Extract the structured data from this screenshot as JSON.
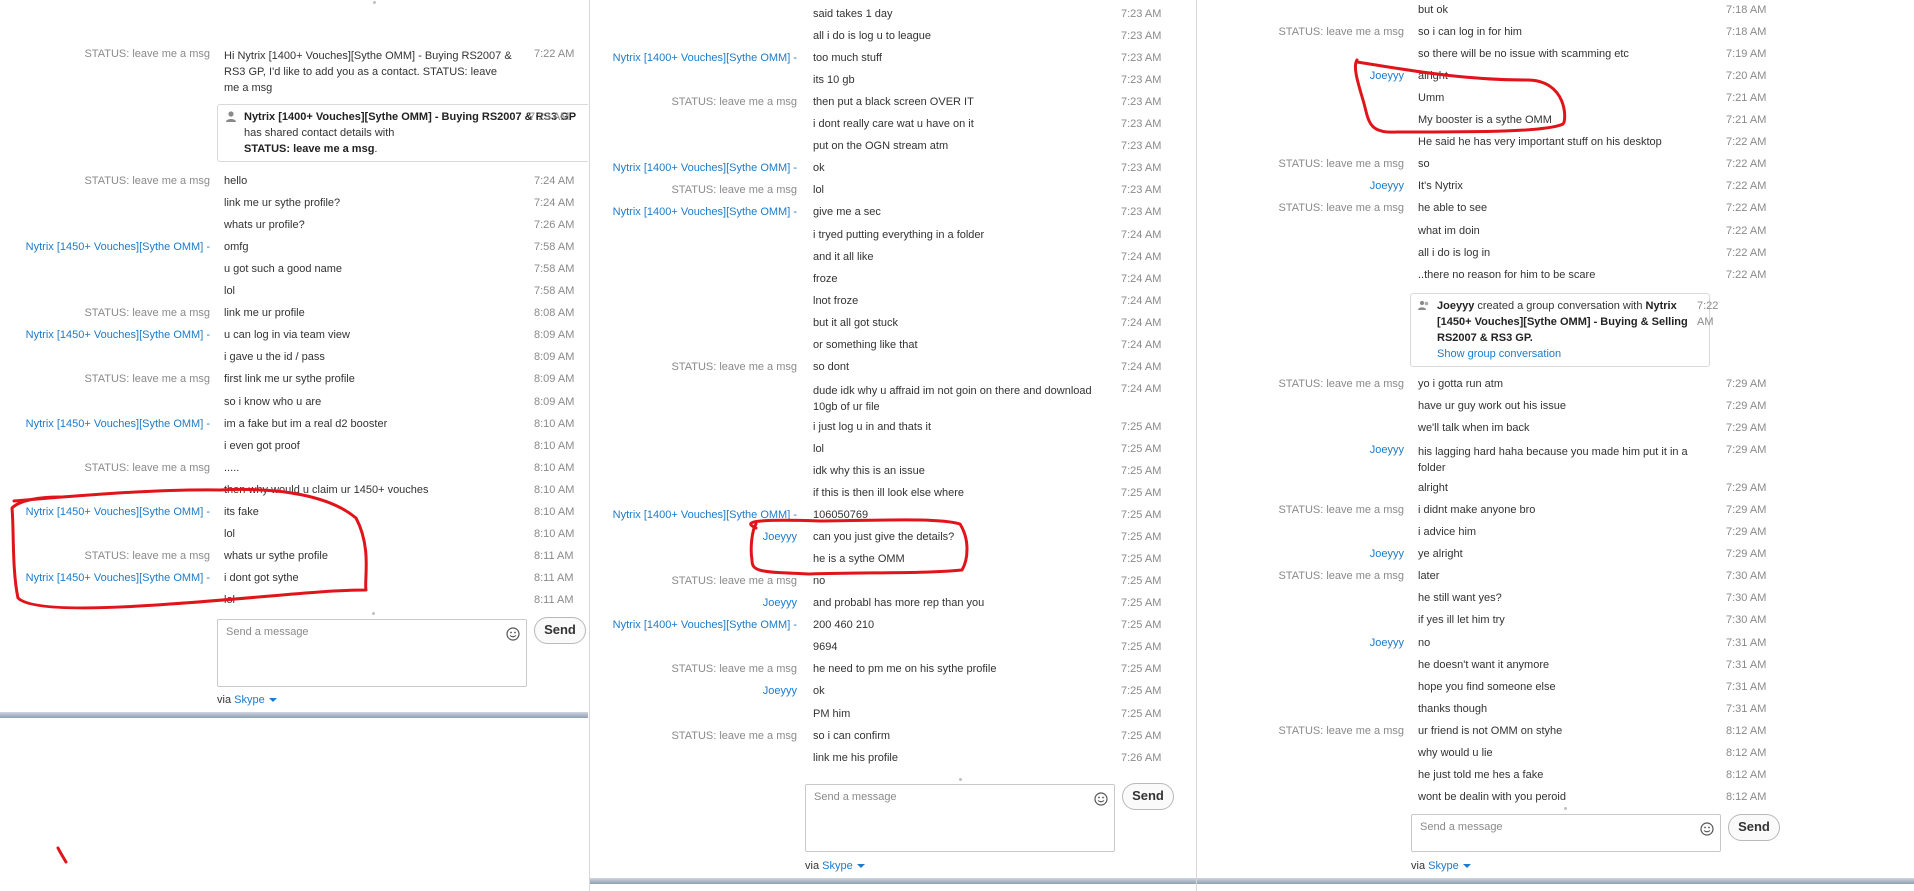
{
  "compose": {
    "placeholder": "Send a message",
    "send_label": "Send",
    "via_prefix": "via",
    "via_link": "Skype"
  },
  "colors": {
    "annotation": "#e0141a",
    "link": "#1d7bc9"
  },
  "panel1": {
    "messages": [
      {
        "sender": "STATUS:  leave me a msg",
        "sender_link": false,
        "text": "Hi Nytrix [1400+ Vouches][Sythe OMM] - Buying RS2007 & RS3 GP, I'd like to add you as a contact. STATUS:  leave me a msg",
        "time": "7:22 AM",
        "multi": true
      },
      {
        "sender": "",
        "sender_link": false,
        "text": "hello",
        "time": "7:24 AM"
      },
      {
        "sender": "STATUS:  leave me a msg",
        "sender_link": false,
        "text": "hello",
        "time": "7:24 AM"
      },
      {
        "sender": "",
        "sender_link": false,
        "text": "link me ur sythe profile?",
        "time": "7:24 AM"
      },
      {
        "sender": "",
        "sender_link": false,
        "text": "whats ur profile?",
        "time": "7:26 AM"
      },
      {
        "sender": "Nytrix [1450+ Vouches][Sythe OMM] -",
        "sender_link": true,
        "text": "omfg",
        "time": "7:58 AM"
      },
      {
        "sender": "",
        "sender_link": false,
        "text": "u got such a good name",
        "time": "7:58 AM"
      },
      {
        "sender": "",
        "sender_link": false,
        "text": "lol",
        "time": "7:58 AM"
      },
      {
        "sender": "STATUS:  leave me a msg",
        "sender_link": false,
        "text": "link me ur profile",
        "time": "8:08 AM"
      },
      {
        "sender": "Nytrix [1450+ Vouches][Sythe OMM] -",
        "sender_link": true,
        "text": "u can log in via team view",
        "time": "8:09 AM"
      },
      {
        "sender": "",
        "sender_link": false,
        "text": "i gave u the id / pass",
        "time": "8:09 AM"
      },
      {
        "sender": "STATUS:  leave me a msg",
        "sender_link": false,
        "text": "first link me ur sythe profile",
        "time": "8:09 AM"
      },
      {
        "sender": "",
        "sender_link": false,
        "text": "so i know who u are",
        "time": "8:09 AM"
      },
      {
        "sender": "Nytrix [1450+ Vouches][Sythe OMM] -",
        "sender_link": true,
        "text": "im a fake but im a real d2 booster",
        "time": "8:10 AM"
      },
      {
        "sender": "",
        "sender_link": false,
        "text": "i even got proof",
        "time": "8:10 AM"
      },
      {
        "sender": "STATUS:  leave me a msg",
        "sender_link": false,
        "text": ".....",
        "time": "8:10 AM"
      },
      {
        "sender": "",
        "sender_link": false,
        "text": "then why would u claim ur 1450+ vouches",
        "time": "8:10 AM"
      },
      {
        "sender": "Nytrix [1450+ Vouches][Sythe OMM] -",
        "sender_link": true,
        "text": "its fake",
        "time": "8:10 AM"
      },
      {
        "sender": "",
        "sender_link": false,
        "text": "lol",
        "time": "8:10 AM"
      },
      {
        "sender": "STATUS:  leave me a msg",
        "sender_link": false,
        "text": "whats ur sythe profile",
        "time": "8:11 AM"
      },
      {
        "sender": "Nytrix [1450+ Vouches][Sythe OMM] -",
        "sender_link": true,
        "text": "i dont got sythe",
        "time": "8:11 AM"
      },
      {
        "sender": "",
        "sender_link": false,
        "text": "lol",
        "time": "8:11 AM"
      }
    ],
    "card": {
      "bold1": "Nytrix [1400+ Vouches][Sythe OMM]",
      "rest1": " - Buying RS2007 & RS3 GP",
      "rest2": " has shared contact details with",
      "bold2": "STATUS:  leave me a msg",
      "rest3": ".",
      "time": "7:23 AM"
    }
  },
  "panel2": {
    "messages": [
      {
        "sender": "",
        "sender_link": false,
        "text": "said takes 1 day",
        "time": "7:23 AM"
      },
      {
        "sender": "",
        "sender_link": false,
        "text": "all i do is log u to league",
        "time": "7:23 AM"
      },
      {
        "sender": "Nytrix [1400+ Vouches][Sythe OMM] -",
        "sender_link": true,
        "text": "too much stuff",
        "time": "7:23 AM"
      },
      {
        "sender": "",
        "sender_link": false,
        "text": "its 10 gb",
        "time": "7:23 AM"
      },
      {
        "sender": "STATUS:  leave me a msg",
        "sender_link": false,
        "text": "then put a black screen OVER IT",
        "time": "7:23 AM"
      },
      {
        "sender": "",
        "sender_link": false,
        "text": "i dont really care wat u have on it",
        "time": "7:23 AM"
      },
      {
        "sender": "",
        "sender_link": false,
        "text": "put on the OGN stream atm",
        "time": "7:23 AM"
      },
      {
        "sender": "Nytrix [1400+ Vouches][Sythe OMM] -",
        "sender_link": true,
        "text": "ok",
        "time": "7:23 AM"
      },
      {
        "sender": "STATUS:  leave me a msg",
        "sender_link": false,
        "text": "lol",
        "time": "7:23 AM"
      },
      {
        "sender": "Nytrix [1400+ Vouches][Sythe OMM] -",
        "sender_link": true,
        "text": "give me a sec",
        "time": "7:23 AM"
      },
      {
        "sender": "",
        "sender_link": false,
        "text": "i tryed putting everything in a folder",
        "time": "7:24 AM"
      },
      {
        "sender": "",
        "sender_link": false,
        "text": "and it all like",
        "time": "7:24 AM"
      },
      {
        "sender": "",
        "sender_link": false,
        "text": "froze",
        "time": "7:24 AM"
      },
      {
        "sender": "",
        "sender_link": false,
        "text": "lnot froze",
        "time": "7:24 AM"
      },
      {
        "sender": "",
        "sender_link": false,
        "text": "but it all got stuck",
        "time": "7:24 AM"
      },
      {
        "sender": "",
        "sender_link": false,
        "text": "or something like that",
        "time": "7:24 AM"
      },
      {
        "sender": "STATUS:  leave me a msg",
        "sender_link": false,
        "text": "so dont",
        "time": "7:24 AM"
      },
      {
        "sender": "",
        "sender_link": false,
        "text": "dude idk why u affraid im not goin on there and download 10gb of ur file",
        "time": "7:24 AM",
        "multi": true
      },
      {
        "sender": "",
        "sender_link": false,
        "text": "i just log u in and thats it",
        "time": "7:25 AM"
      },
      {
        "sender": "",
        "sender_link": false,
        "text": "lol",
        "time": "7:25 AM"
      },
      {
        "sender": "",
        "sender_link": false,
        "text": "idk why this is an issue",
        "time": "7:25 AM"
      },
      {
        "sender": "",
        "sender_link": false,
        "text": "if this is then ill look else where",
        "time": "7:25 AM"
      },
      {
        "sender": "Nytrix [1400+ Vouches][Sythe OMM] -",
        "sender_link": true,
        "text": "106050769",
        "time": "7:25 AM"
      },
      {
        "sender": "Joeyyy",
        "sender_link": true,
        "text": "can you just give the details?",
        "time": "7:25 AM"
      },
      {
        "sender": "",
        "sender_link": false,
        "text": "he is a sythe OMM",
        "time": "7:25 AM"
      },
      {
        "sender": "STATUS:  leave me a msg",
        "sender_link": false,
        "text": "no",
        "time": "7:25 AM"
      },
      {
        "sender": "Joeyyy",
        "sender_link": true,
        "text": "and probabl has more rep than you",
        "time": "7:25 AM"
      },
      {
        "sender": "Nytrix [1400+ Vouches][Sythe OMM] -",
        "sender_link": true,
        "text": "200 460 210",
        "time": "7:25 AM"
      },
      {
        "sender": "",
        "sender_link": false,
        "text": "9694",
        "time": "7:25 AM"
      },
      {
        "sender": "STATUS:  leave me a msg",
        "sender_link": false,
        "text": "he need to pm me on his sythe profile",
        "time": "7:25 AM"
      },
      {
        "sender": "Joeyyy",
        "sender_link": true,
        "text": "ok",
        "time": "7:25 AM"
      },
      {
        "sender": "",
        "sender_link": false,
        "text": "PM him",
        "time": "7:25 AM"
      },
      {
        "sender": "STATUS:  leave me a msg",
        "sender_link": false,
        "text": "so i can confirm",
        "time": "7:25 AM"
      },
      {
        "sender": "",
        "sender_link": false,
        "text": "link me his profile",
        "time": "7:26 AM"
      }
    ]
  },
  "panel3": {
    "messages": [
      {
        "sender": "",
        "sender_link": false,
        "text": "but ok",
        "time": "7:18 AM"
      },
      {
        "sender": "STATUS:  leave me a msg",
        "sender_link": false,
        "text": "so i can log in for him",
        "time": "7:18 AM"
      },
      {
        "sender": "",
        "sender_link": false,
        "text": "so there will be no issue with scamming etc",
        "time": "7:19 AM"
      },
      {
        "sender": "Joeyyy",
        "sender_link": true,
        "text": "alright",
        "time": "7:20 AM"
      },
      {
        "sender": "",
        "sender_link": false,
        "text": "Umm",
        "time": "7:21 AM"
      },
      {
        "sender": "",
        "sender_link": false,
        "text": "My booster is a sythe OMM",
        "time": "7:21 AM"
      },
      {
        "sender": "",
        "sender_link": false,
        "text": "He said he has very important stuff on his desktop",
        "time": "7:22 AM"
      },
      {
        "sender": "STATUS:  leave me a msg",
        "sender_link": false,
        "text": "so",
        "time": "7:22 AM"
      },
      {
        "sender": "Joeyyy",
        "sender_link": true,
        "text": "It's Nytrix",
        "time": "7:22 AM"
      },
      {
        "sender": "STATUS:  leave me a msg",
        "sender_link": false,
        "text": "he able to see",
        "time": "7:22 AM"
      },
      {
        "sender": "",
        "sender_link": false,
        "text": "what im doin",
        "time": "7:22 AM"
      },
      {
        "sender": "",
        "sender_link": false,
        "text": "all i do is log in",
        "time": "7:22 AM"
      },
      {
        "sender": "",
        "sender_link": false,
        "text": "..there no reason for him to be scare",
        "time": "7:22 AM"
      },
      {
        "sender": "STATUS:  leave me a msg",
        "sender_link": false,
        "text": "yo i gotta run atm",
        "time": "7:29 AM"
      },
      {
        "sender": "",
        "sender_link": false,
        "text": "have ur guy work out his issue",
        "time": "7:29 AM"
      },
      {
        "sender": "",
        "sender_link": false,
        "text": "we'll talk when im back",
        "time": "7:29 AM"
      },
      {
        "sender": "Joeyyy",
        "sender_link": true,
        "text": "his lagging hard haha because you made him put it in a folder",
        "time": "7:29 AM",
        "multi": true
      },
      {
        "sender": "",
        "sender_link": false,
        "text": "alright",
        "time": "7:29 AM"
      },
      {
        "sender": "STATUS:  leave me a msg",
        "sender_link": false,
        "text": "i didnt make anyone bro",
        "time": "7:29 AM"
      },
      {
        "sender": "",
        "sender_link": false,
        "text": "i advice him",
        "time": "7:29 AM"
      },
      {
        "sender": "Joeyyy",
        "sender_link": true,
        "text": "ye alright",
        "time": "7:29 AM"
      },
      {
        "sender": "STATUS:  leave me a msg",
        "sender_link": false,
        "text": "later",
        "time": "7:30 AM"
      },
      {
        "sender": "",
        "sender_link": false,
        "text": "he still want yes?",
        "time": "7:30 AM"
      },
      {
        "sender": "",
        "sender_link": false,
        "text": "if yes ill let him try",
        "time": "7:30 AM"
      },
      {
        "sender": "Joeyyy",
        "sender_link": true,
        "text": "no",
        "time": "7:31 AM"
      },
      {
        "sender": "",
        "sender_link": false,
        "text": "he doesn't want it anymore",
        "time": "7:31 AM"
      },
      {
        "sender": "",
        "sender_link": false,
        "text": "hope you find someone else",
        "time": "7:31 AM"
      },
      {
        "sender": "",
        "sender_link": false,
        "text": "thanks though",
        "time": "7:31 AM"
      },
      {
        "sender": "STATUS:  leave me a msg",
        "sender_link": false,
        "text": "ur friend is not OMM on styhe",
        "time": "8:12 AM"
      },
      {
        "sender": "",
        "sender_link": false,
        "text": "why would u lie",
        "time": "8:12 AM"
      },
      {
        "sender": "",
        "sender_link": false,
        "text": "he just told me hes a fake",
        "time": "8:12 AM"
      },
      {
        "sender": "",
        "sender_link": false,
        "text": "wont be dealin with you peroid",
        "time": "8:12 AM"
      }
    ],
    "card": {
      "bold1": "Joeyyy",
      "rest1": " created a group conversation with ",
      "bold2": "Nytrix [1450+ Vouches][Sythe OMM] - Buying & Selling RS2007 & RS3 GP.",
      "link": "Show group conversation",
      "time": "7:22 AM"
    }
  }
}
